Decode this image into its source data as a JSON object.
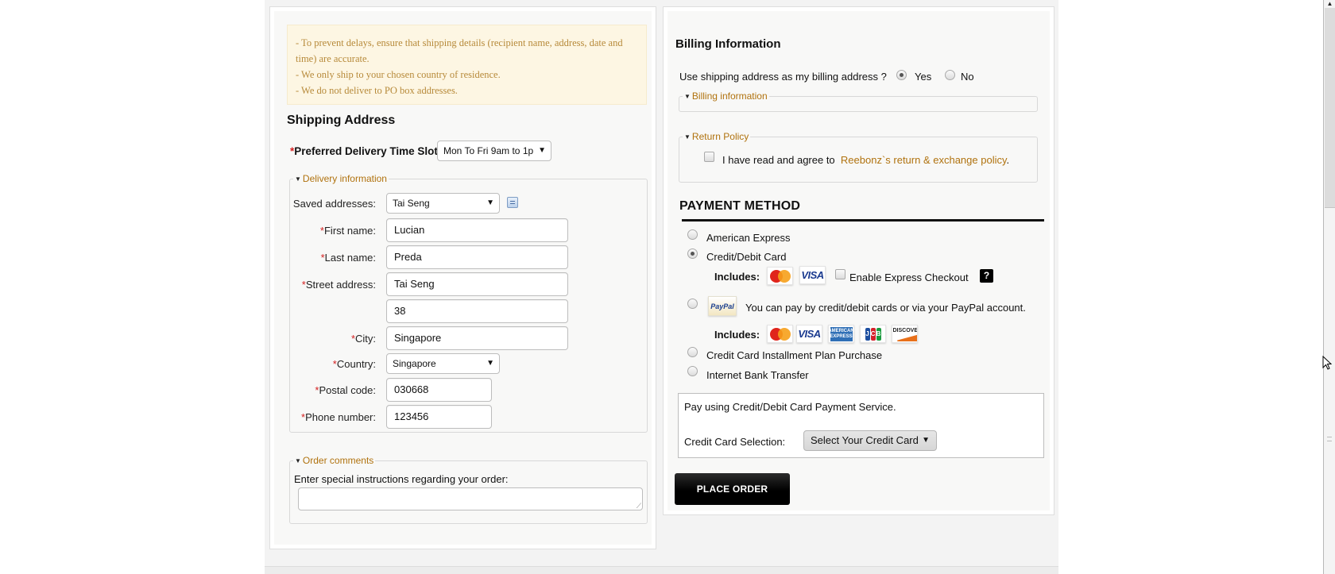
{
  "notice": {
    "lines": [
      "- To prevent delays, ensure that shipping details (recipient name, address, date and time) are accurate.",
      "- We only ship to your chosen country of residence.",
      "- We do not deliver to PO box addresses."
    ]
  },
  "shipping": {
    "title": "Shipping Address",
    "delivery_slot_label": "Preferred Delivery Time Slot:",
    "delivery_slot_value": "Mon To Fri 9am to 1p",
    "delivery_legend": "Delivery information",
    "saved_addresses_label": "Saved addresses:",
    "saved_addresses_value": "Tai Seng",
    "fields": {
      "first_name": {
        "label": "First name:",
        "value": "Lucian"
      },
      "last_name": {
        "label": "Last name:",
        "value": "Preda"
      },
      "street_address": {
        "label": "Street address:",
        "value": "Tai Seng"
      },
      "street_address_2": {
        "value": "38"
      },
      "city": {
        "label": "City:",
        "value": "Singapore"
      },
      "country": {
        "label": "Country:",
        "value": "Singapore"
      },
      "postal_code": {
        "label": "Postal code:",
        "value": "030668"
      },
      "phone_number": {
        "label": "Phone number:",
        "value": "123456"
      }
    },
    "required_mark": "*",
    "order_comments_legend": "Order comments",
    "order_comments_label": "Enter special instructions regarding your order:",
    "order_comments_value": ""
  },
  "billing": {
    "title": "Billing Information",
    "use_shipping_question": "Use shipping address as my billing address ?",
    "yes_label": "Yes",
    "no_label": "No",
    "use_shipping_selected": "Yes",
    "billing_legend": "Billing information",
    "return_policy_legend": "Return Policy",
    "agree_text": "I have read and agree to",
    "agree_link": "Reebonz`s return & exchange policy",
    "agree_period": ".",
    "agree_checked": false
  },
  "payment": {
    "title": "PAYMENT METHOD",
    "selected": "Credit/Debit Card",
    "options": [
      {
        "label": "American Express"
      },
      {
        "label": "Credit/Debit Card"
      },
      {
        "label": "You can pay by credit/debit cards or via your PayPal account."
      },
      {
        "label": "Credit Card Installment Plan Purchase"
      },
      {
        "label": "Internet Bank Transfer"
      }
    ],
    "includes_label": "Includes:",
    "express_checkout_label": "Enable Express Checkout",
    "express_checkout_checked": false,
    "help_label": "?",
    "card_logos": {
      "mastercard": "MasterCard",
      "visa": "VISA",
      "amex": "AMERICAN EXPRESS",
      "jcb": "JCB",
      "discover": "DISCOVER",
      "paypal": "PayPal"
    },
    "info_text": "Pay using Credit/Debit Card Payment Service.",
    "cc_selection_label": "Credit Card Selection:",
    "cc_selection_value": "Select Your Credit Card",
    "place_order_label": "PLACE ORDER"
  },
  "colors": {
    "accent_link": "#b0720e",
    "required": "#d42020",
    "notice_text": "#b78a3a",
    "notice_bg": "#fdf6e3"
  }
}
